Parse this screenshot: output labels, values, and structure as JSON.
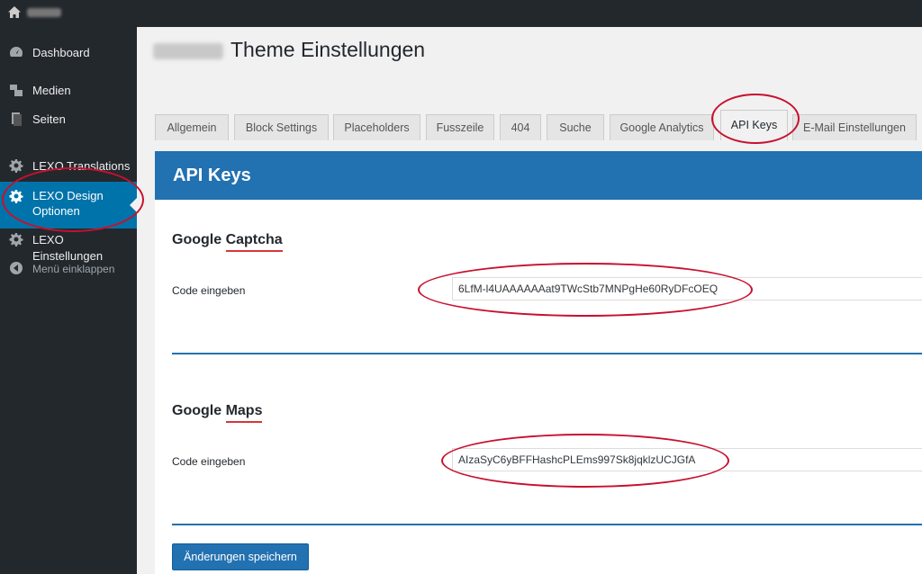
{
  "adminbar": {
    "home_icon": "home-icon"
  },
  "sidebar": {
    "items": [
      {
        "label": "Dashboard",
        "icon": "dashboard-icon"
      },
      {
        "label": "Medien",
        "icon": "media-icon"
      },
      {
        "label": "Seiten",
        "icon": "pages-icon"
      },
      {
        "label": "LEXO Translations",
        "icon": "gear-icon"
      },
      {
        "label_line1": "LEXO Design",
        "label_line2": "Optionen",
        "icon": "gear-icon",
        "active": true
      },
      {
        "label": "LEXO Einstellungen",
        "icon": "gear-icon"
      },
      {
        "label": "Menü einklappen",
        "icon": "collapse-icon"
      }
    ]
  },
  "page": {
    "title": "Theme Einstellungen"
  },
  "tabs": [
    {
      "label": "Allgemein"
    },
    {
      "label": "Block Settings"
    },
    {
      "label": "Placeholders"
    },
    {
      "label": "Fusszeile"
    },
    {
      "label": "404"
    },
    {
      "label": "Suche"
    },
    {
      "label": "Google Analytics"
    },
    {
      "label": "API Keys",
      "active": true
    },
    {
      "label": "E-Mail Einstellungen"
    }
  ],
  "panel": {
    "heading": "API Keys",
    "sections": [
      {
        "title_plain": "Google ",
        "title_highlight": "Captcha",
        "field_label": "Code eingeben",
        "value": "6LfM-l4UAAAAAAat9TWcStb7MNPgHe60RyDFcOEQ"
      },
      {
        "title_plain": "Google ",
        "title_highlight": "Maps",
        "field_label": "Code eingeben",
        "value": "AIzaSyC6yBFFHashcPLEms997Sk8jqklzUCJGfA"
      }
    ],
    "save_label": "Änderungen speichern"
  },
  "colors": {
    "accent": "#2271b1",
    "sidebar_bg": "#23282d",
    "annotation": "#c8102e"
  }
}
